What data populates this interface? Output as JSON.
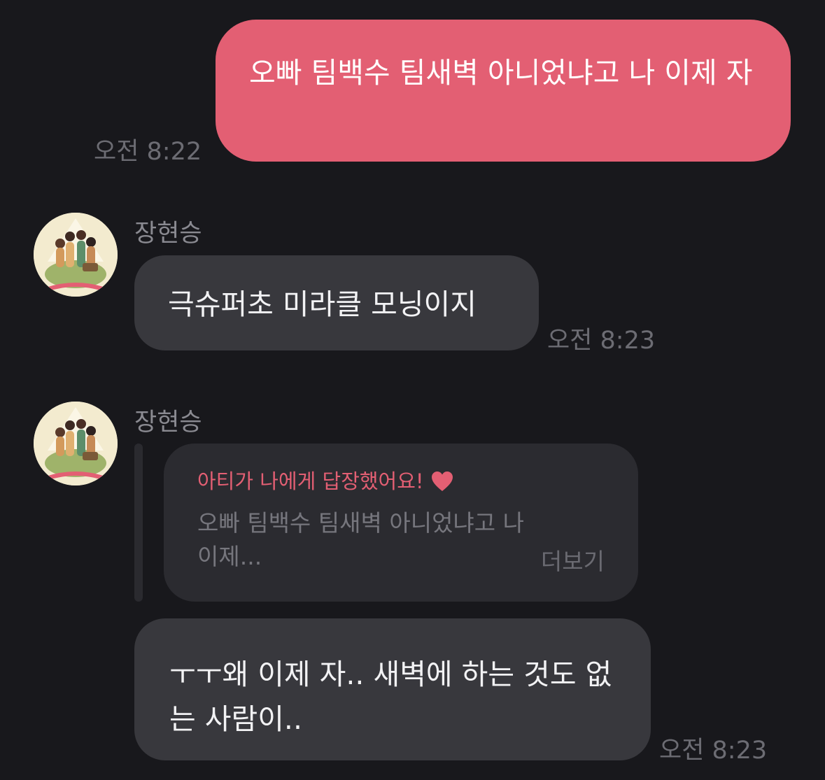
{
  "messages": [
    {
      "text": "오빠 팀백수 팀새벽 아니었냐고 나 이제 자",
      "time": "오전 8:22"
    },
    {
      "sender": "장현승",
      "text": "극슈퍼초 미라클 모닝이지",
      "time": "오전 8:23"
    },
    {
      "sender": "장현승",
      "reply": {
        "title": "아티가 나에게 답장했어요!",
        "quote": "오빠 팀백수 팀새벽 아니었냐고 나 이제...",
        "more": "더보기"
      },
      "text": "ㅜㅜ왜 이제 자.. 새벽에 하는 것도 없는 사람이..",
      "time": "오전 8:23"
    }
  ],
  "colors": {
    "outgoing": "#e35f73",
    "incoming": "#38383d",
    "background": "#18181c"
  },
  "icons": {
    "reply_heart": "heart-icon",
    "avatar": "profile-avatar"
  }
}
